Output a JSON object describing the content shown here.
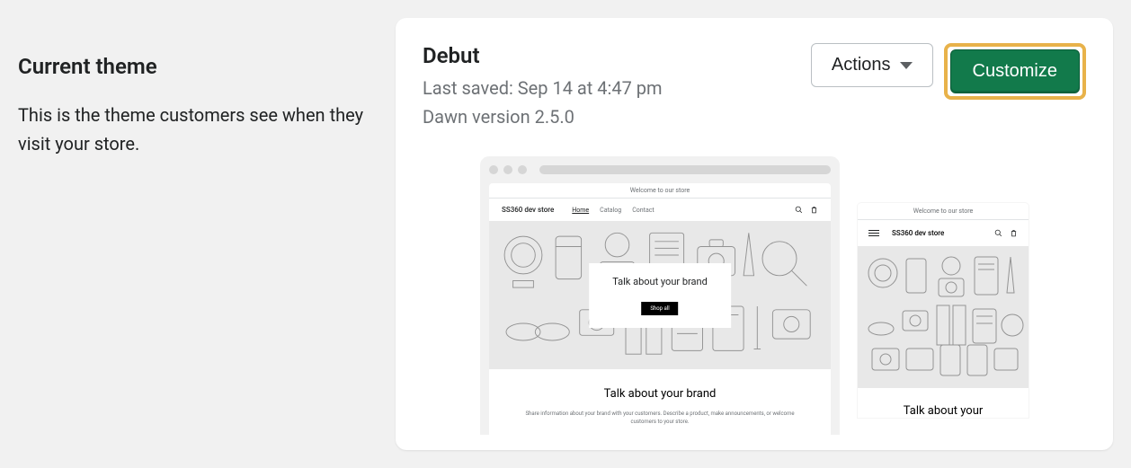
{
  "sidebar": {
    "heading": "Current theme",
    "description": "This is the theme customers see when they visit your store."
  },
  "theme": {
    "name": "Debut",
    "last_saved": "Last saved: Sep 14 at 4:47 pm",
    "version": "Dawn version 2.5.0",
    "actions_label": "Actions",
    "customize_label": "Customize"
  },
  "preview": {
    "banner": "Welcome to our store",
    "store_name": "SS360 dev store",
    "nav": {
      "home": "Home",
      "catalog": "Catalog",
      "contact": "Contact"
    },
    "hero_title": "Talk about your brand",
    "hero_cta": "Shop all",
    "section_title": "Talk about your brand",
    "section_body": "Share information about your brand with your customers. Describe a product, make announcements, or welcome customers to your store.",
    "mobile_section_title": "Talk about your"
  }
}
